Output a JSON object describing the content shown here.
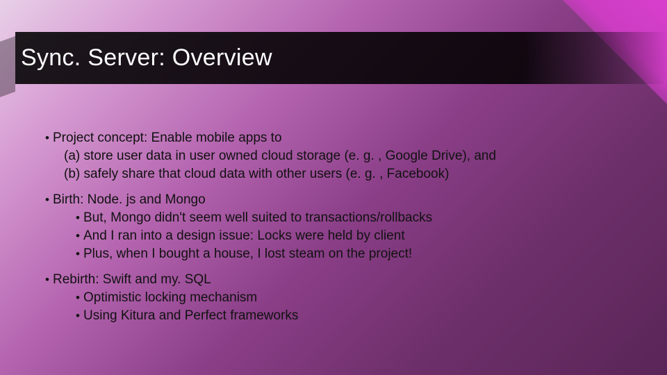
{
  "title": "Sync. Server: Overview",
  "bullets": {
    "b1": {
      "head": "Project concept: Enable mobile apps to",
      "subA": "(a) store user data in user owned cloud storage (e. g. , Google Drive), and",
      "subB": "(b) safely share that cloud data with other users (e. g. , Facebook)"
    },
    "b2": {
      "head": "Birth: Node. js and Mongo",
      "items": [
        "But, Mongo didn't seem well suited to transactions/rollbacks",
        "And I ran into a design issue: Locks were held by client",
        "Plus, when I bought a house, I lost steam on the project!"
      ]
    },
    "b3": {
      "head": "Rebirth: Swift and my. SQL",
      "items": [
        "Optimistic locking mechanism",
        "Using Kitura and Perfect frameworks"
      ]
    }
  }
}
